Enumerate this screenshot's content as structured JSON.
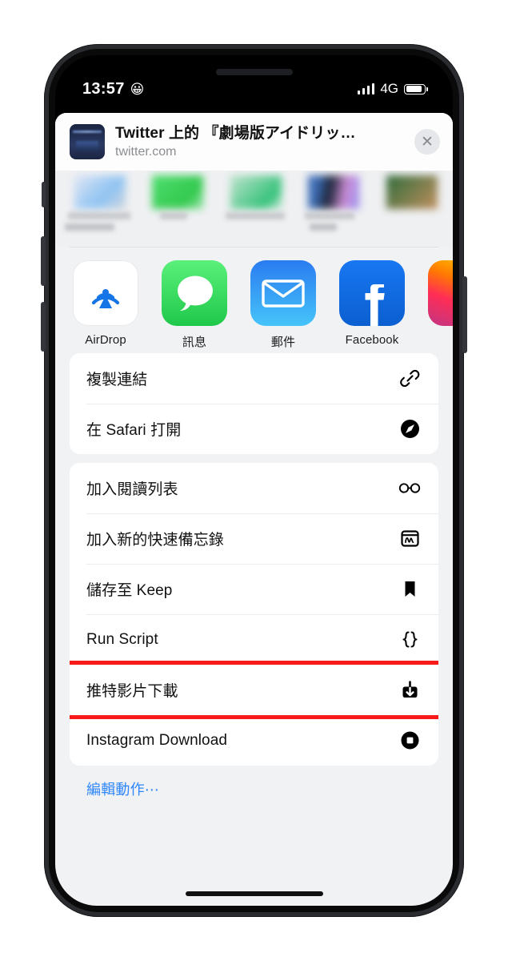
{
  "status_bar": {
    "time": "13:57",
    "focus_emoji": "😀",
    "network": "4G",
    "signal_bars": 4,
    "battery_level": "78"
  },
  "share_sheet": {
    "header": {
      "title": "Twitter 上的 『劇場版アイドリッ…",
      "subtitle": "twitter.com",
      "thumbnail_name": "link-preview-thumbnail",
      "close_label": "✕"
    },
    "people_row": {
      "redacted": true,
      "count": 4
    },
    "apps": [
      {
        "label": "AirDrop",
        "icon": "airdrop-icon"
      },
      {
        "label": "訊息",
        "icon": "messages-icon"
      },
      {
        "label": "郵件",
        "icon": "mail-icon"
      },
      {
        "label": "Facebook",
        "icon": "facebook-icon"
      },
      {
        "label": "",
        "icon": "instagram-icon"
      }
    ],
    "action_groups": [
      {
        "rows": [
          {
            "label": "複製連結",
            "icon": "link-icon",
            "highlighted": false
          },
          {
            "label": "在 Safari 打開",
            "icon": "safari-compass-icon",
            "highlighted": false
          }
        ]
      },
      {
        "rows": [
          {
            "label": "加入閱讀列表",
            "icon": "glasses-icon",
            "highlighted": false
          },
          {
            "label": "加入新的快速備忘錄",
            "icon": "quick-note-icon",
            "highlighted": false
          },
          {
            "label": "儲存至 Keep",
            "icon": "bookmark-icon",
            "highlighted": false
          },
          {
            "label": "Run Script",
            "icon": "curly-braces-icon",
            "highlighted": false
          },
          {
            "label": "推特影片下載",
            "icon": "download-box-icon",
            "highlighted": true
          },
          {
            "label": "Instagram Download",
            "icon": "stop-circle-icon",
            "highlighted": false
          }
        ]
      }
    ],
    "edit_actions_label": "編輯動作⋯",
    "accent_color": "#2f87fb",
    "highlight_color": "#f71a18"
  }
}
